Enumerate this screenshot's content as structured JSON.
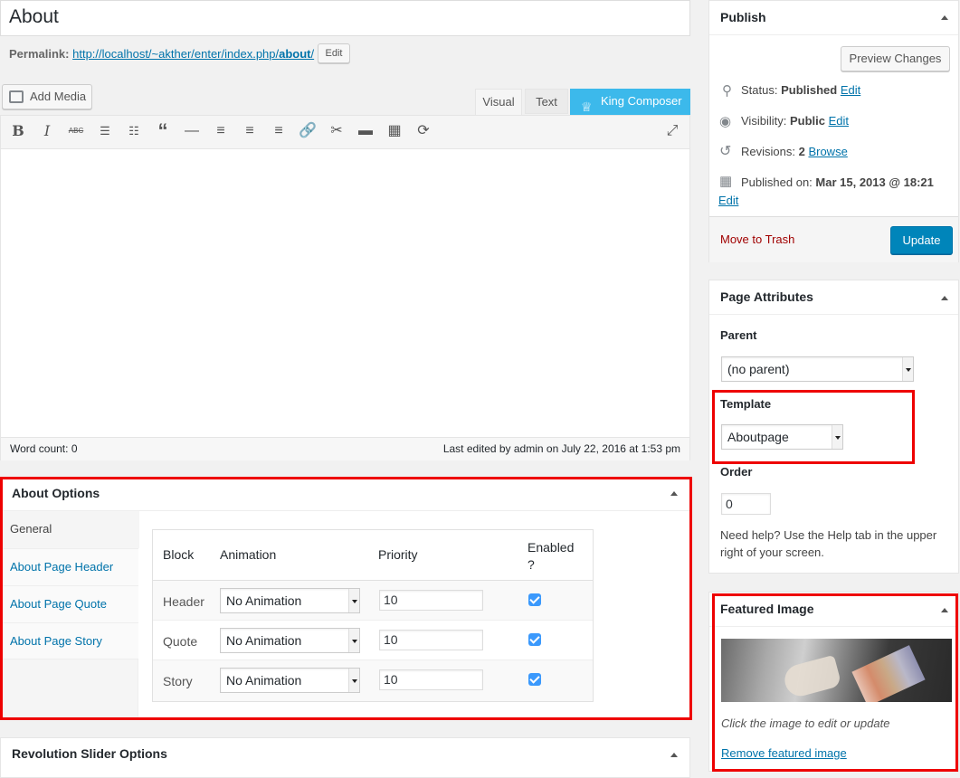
{
  "title": {
    "value": "About"
  },
  "permalink": {
    "label": "Permalink:",
    "url_prefix": "http://localhost/~akther/enter/index.php/",
    "url_slug": "about",
    "url_suffix": "/",
    "edit_button": "Edit"
  },
  "editor": {
    "add_media": "Add Media",
    "tabs": {
      "visual": "Visual",
      "text": "Text",
      "king": "King Composer"
    },
    "word_count_label": "Word count:",
    "word_count": "0",
    "last_edited": "Last edited by admin on July 22, 2016 at 1:53 pm"
  },
  "about_options": {
    "title": "About Options",
    "tabs": [
      "General",
      "About Page Header",
      "About Page Quote",
      "About Page Story"
    ],
    "headers": {
      "block": "Block",
      "animation": "Animation",
      "priority": "Priority",
      "enabled": "Enabled ?"
    },
    "rows": [
      {
        "block": "Header",
        "animation": "No Animation",
        "priority": "10",
        "enabled": true
      },
      {
        "block": "Quote",
        "animation": "No Animation",
        "priority": "10",
        "enabled": true
      },
      {
        "block": "Story",
        "animation": "No Animation",
        "priority": "10",
        "enabled": true
      }
    ]
  },
  "revolution": {
    "title": "Revolution Slider Options"
  },
  "publish": {
    "title": "Publish",
    "preview_button": "Preview Changes",
    "status_label": "Status:",
    "status_value": "Published",
    "visibility_label": "Visibility:",
    "visibility_value": "Public",
    "revisions_label": "Revisions:",
    "revisions_value": "2",
    "browse_link": "Browse",
    "published_label": "Published on:",
    "published_value": "Mar 15, 2013 @ 18:21",
    "edit_link": "Edit",
    "trash_link": "Move to Trash",
    "update_button": "Update"
  },
  "page_attributes": {
    "title": "Page Attributes",
    "parent_label": "Parent",
    "parent_value": "(no parent)",
    "template_label": "Template",
    "template_value": "Aboutpage",
    "order_label": "Order",
    "order_value": "0",
    "help_text": "Need help? Use the Help tab in the upper right of your screen."
  },
  "featured_image": {
    "title": "Featured Image",
    "hint": "Click the image to edit or update",
    "remove_link": "Remove featured image"
  },
  "colors": {
    "link": "#0073aa",
    "primary_button": "#0085ba",
    "trash": "#a00000",
    "highlight": "#ee0000",
    "king_tab": "#3cb9eb"
  }
}
